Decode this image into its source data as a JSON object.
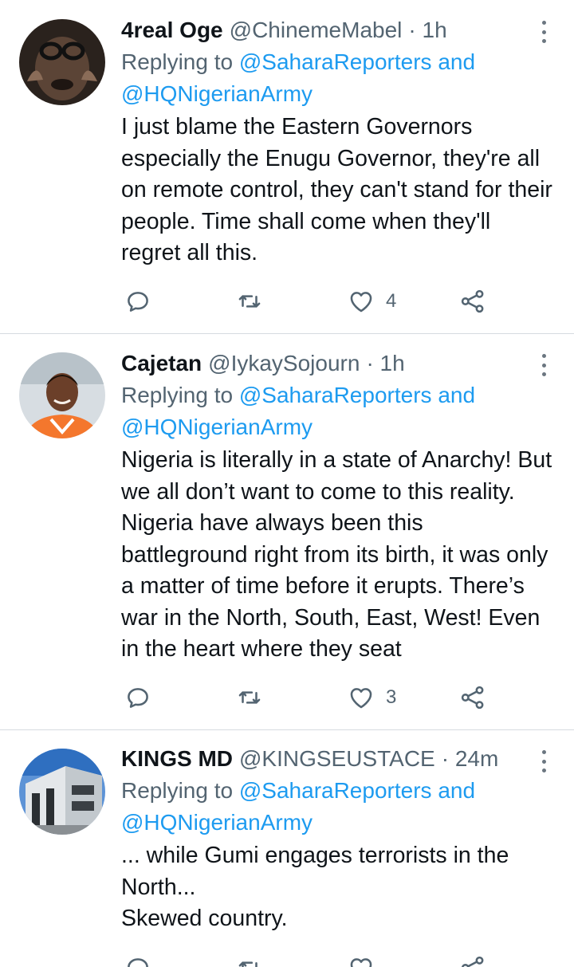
{
  "colors": {
    "accent": "#1d9bf0",
    "secondary_text": "#536471",
    "primary_text": "#0f1419",
    "divider": "#d6dbe0"
  },
  "tweets": [
    {
      "name": "4real Oge",
      "handle": "@ChinemeMabel",
      "time": "· 1h",
      "replying_prefix": "Replying to",
      "replying_to_1": "@SaharaReporters",
      "replying_and": "and",
      "replying_to_2": "@HQNigerianArmy",
      "text": "I just blame the Eastern Governors especially the Enugu Governor, they're all on remote control, they can't stand for their people. Time shall come when they'll regret all this.",
      "like_count": "4",
      "icons": [
        "reply-icon",
        "retweet-icon",
        "heart-icon",
        "share-icon",
        "more-icon"
      ]
    },
    {
      "name": "Cajetan",
      "handle": "@IykaySojourn",
      "time": "· 1h",
      "replying_prefix": "Replying to",
      "replying_to_1": "@SaharaReporters",
      "replying_and": "and",
      "replying_to_2": "@HQNigerianArmy",
      "text": "Nigeria is literally in a state of Anarchy! But we all don’t want to come to this reality. Nigeria have always been this battleground right from its birth, it was only a matter of time before it erupts. There’s war in the North, South, East, West! Even in the heart where they seat",
      "like_count": "3",
      "icons": [
        "reply-icon",
        "retweet-icon",
        "heart-icon",
        "share-icon",
        "more-icon"
      ]
    },
    {
      "name": "KINGS MD",
      "handle": "@KINGSEUSTACE",
      "time": "· 24m",
      "replying_prefix": "Replying to",
      "replying_to_1": "@SaharaReporters",
      "replying_and": "and",
      "replying_to_2": "@HQNigerianArmy",
      "text": "... while Gumi engages terrorists in the North...\nSkewed country.",
      "like_count": "",
      "icons": [
        "reply-icon",
        "retweet-icon",
        "heart-icon",
        "share-icon",
        "more-icon"
      ]
    }
  ]
}
